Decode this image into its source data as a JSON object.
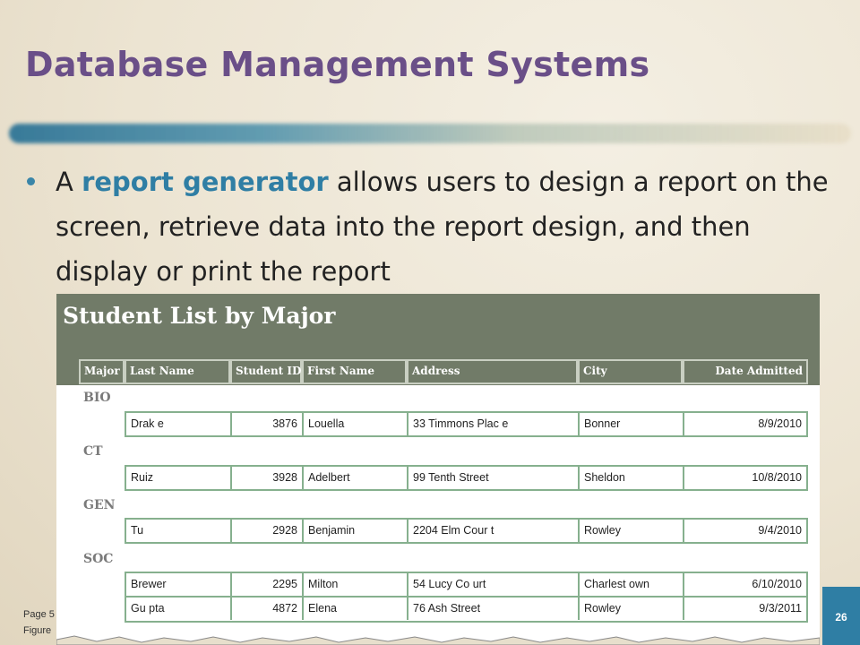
{
  "slide": {
    "title": "Database Management Systems",
    "bullet": {
      "before": "A ",
      "highlight": "report generator",
      "after": " allows users to design a report on the screen, retrieve data into the report design, and then display or print the report"
    },
    "footer_line1": "Page 5",
    "footer_line2": "Figure",
    "page_number": "26"
  },
  "colors": {
    "title": "#6a4f88",
    "accent": "#2f7ea4",
    "figure_header": "#717b68",
    "row_border": "#86b08e"
  },
  "report": {
    "title": "Student List by Major",
    "columns": [
      "Major",
      "Last Name",
      "Student ID",
      "First Name",
      "Address",
      "City",
      "Date Admitted"
    ],
    "groups": [
      {
        "major": "BIO",
        "rows": [
          {
            "last": "Drak e",
            "id": "3876",
            "first": "Louella",
            "address": "33 Timmons Plac e",
            "city": "Bonner",
            "date": "8/9/2010"
          }
        ]
      },
      {
        "major": "CT",
        "rows": [
          {
            "last": "Ruiz",
            "id": "3928",
            "first": "Adelbert",
            "address": "99 Tenth Street",
            "city": "Sheldon",
            "date": "10/8/2010"
          }
        ]
      },
      {
        "major": "GEN",
        "rows": [
          {
            "last": "Tu",
            "id": "2928",
            "first": "Benjamin",
            "address": "2204 Elm Cour t",
            "city": "Rowley",
            "date": "9/4/2010"
          }
        ]
      },
      {
        "major": "SOC",
        "rows": [
          {
            "last": "Brewer",
            "id": "2295",
            "first": "Milton",
            "address": "54 Lucy Co urt",
            "city": "Charlest own",
            "date": "6/10/2010"
          },
          {
            "last": "Gu pta",
            "id": "4872",
            "first": "Elena",
            "address": "76 Ash Street",
            "city": "Rowley",
            "date": "9/3/2011"
          }
        ]
      }
    ]
  }
}
